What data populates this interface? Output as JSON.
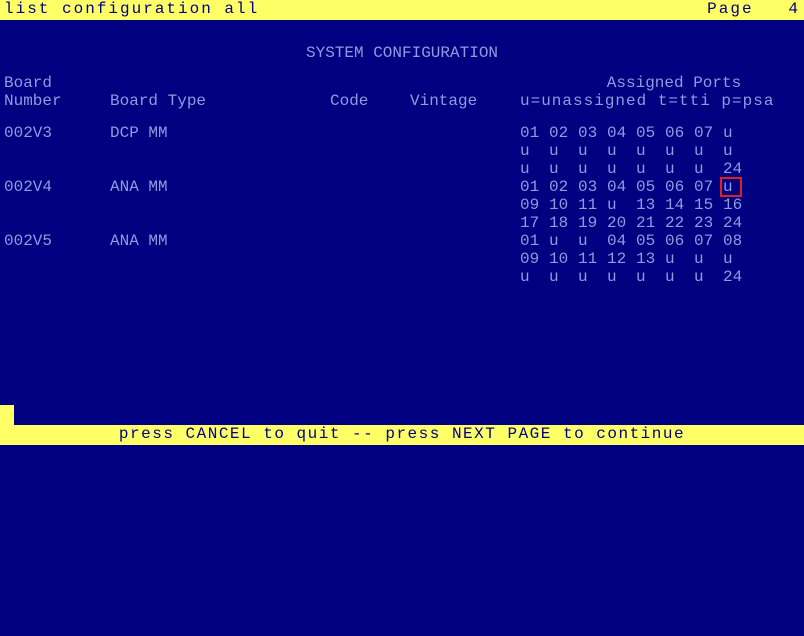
{
  "titlebar": {
    "command": "list configuration all",
    "page_label": "Page",
    "page_num": "4"
  },
  "screen_title": "SYSTEM CONFIGURATION",
  "headers": {
    "board_number_l1": "Board",
    "board_number_l2": "Number",
    "board_type": "Board Type",
    "code": "Code",
    "vintage": "Vintage",
    "assigned_ports": "Assigned Ports",
    "legend": "u=unassigned t=tti p=psa"
  },
  "boards": [
    {
      "number": "002V3",
      "type": "DCP MM",
      "code": "",
      "vintage": "",
      "ports": [
        [
          "01",
          "02",
          "03",
          "04",
          "05",
          "06",
          "07",
          "u"
        ],
        [
          "u",
          "u",
          "u",
          "u",
          "u",
          "u",
          "u",
          "u"
        ],
        [
          "u",
          "u",
          "u",
          "u",
          "u",
          "u",
          "u",
          "24"
        ]
      ],
      "cursor": null
    },
    {
      "number": "002V4",
      "type": "ANA MM",
      "code": "",
      "vintage": "",
      "ports": [
        [
          "01",
          "02",
          "03",
          "04",
          "05",
          "06",
          "07",
          "u"
        ],
        [
          "09",
          "10",
          "11",
          "u",
          "13",
          "14",
          "15",
          "16"
        ],
        [
          "17",
          "18",
          "19",
          "20",
          "21",
          "22",
          "23",
          "24"
        ]
      ],
      "cursor": {
        "row": 0,
        "col": 7
      }
    },
    {
      "number": "002V5",
      "type": "ANA MM",
      "code": "",
      "vintage": "",
      "ports": [
        [
          "01",
          "u",
          "u",
          "04",
          "05",
          "06",
          "07",
          "08"
        ],
        [
          "09",
          "10",
          "11",
          "12",
          "13",
          "u",
          "u",
          "u"
        ],
        [
          "u",
          "u",
          "u",
          "u",
          "u",
          "u",
          "u",
          "24"
        ]
      ],
      "cursor": null
    }
  ],
  "status": "press CANCEL to quit --  press NEXT PAGE to continue"
}
